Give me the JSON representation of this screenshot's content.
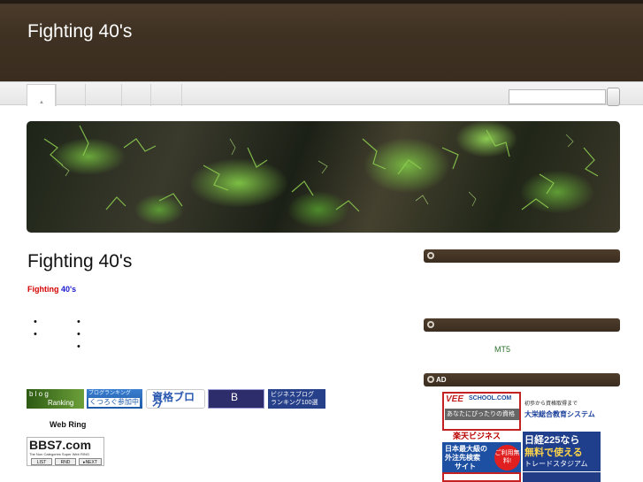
{
  "site": {
    "title": "Fighting 40's"
  },
  "nav": {
    "tabs": [
      {
        "label": ""
      },
      {
        "label": ""
      },
      {
        "label": ""
      },
      {
        "label": ""
      },
      {
        "label": ""
      }
    ],
    "search": {
      "placeholder": "",
      "value": ""
    }
  },
  "main": {
    "post_title": "Fighting 40's",
    "blog_name": {
      "part1": "Fighting",
      "part2": "40's"
    },
    "bullets_col1": [
      "",
      ""
    ],
    "bullets_col2": [
      "",
      "",
      ""
    ],
    "banners": {
      "blogranking_line1": "b l o g",
      "blogranking_line2": "Ranking",
      "tsurutsuru_top": "ブログランキング",
      "tsurutsuru_bottom": "くつろぐ参加中",
      "shikaku": "資格ブログ",
      "crown": "B",
      "biz_line1": "ビジネスブログ",
      "biz_line2": "ランキング100選"
    },
    "webring_label": "Web Ring",
    "bbs7": {
      "logo": "BBS7.com",
      "subtitle": "The Non Categories Super Web RING",
      "list": "LIST",
      "rnd": "RND",
      "next": "▸NEXT"
    }
  },
  "sidebar": {
    "widget1_title": "",
    "widget2_title": "",
    "mt5_link": "MT5",
    "ad_title": "AD",
    "ads": {
      "vee_logo": "VEE",
      "vee_logo2": "SCHOOL.COM",
      "vee_text": "あなたにぴったりの資格",
      "kyo_line1": "初歩から資格取得まで",
      "kyo_line2": "大栄総合教育システム",
      "raku_head": "楽天ビジネス",
      "raku_l1": "日本最大級の",
      "raku_l2": "外注先検索",
      "raku_l3": "サイト",
      "raku_badge": "ご利用無料!",
      "nk_l1": "日経225なら",
      "nk_l2": "無料で使える",
      "nk_l3": "トレードスタジアム"
    }
  },
  "colors": {
    "header_bg": "#3f3122",
    "sidebar_head_bg": "#4a3a29",
    "blog_name_red": "#d40000",
    "blog_name_blue": "#1a1acc",
    "link_green": "#2a6f2a"
  }
}
